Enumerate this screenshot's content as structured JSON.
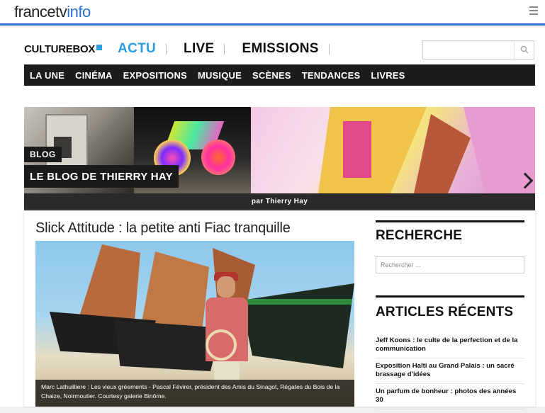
{
  "header": {
    "logo_part1": "francetv",
    "logo_part2": "info"
  },
  "brand": {
    "culturebox": "CULTUREBOX",
    "nav": [
      "ACTU",
      "LIVE",
      "EMISSIONS"
    ]
  },
  "menu": [
    "LA UNE",
    "CINÉMA",
    "EXPOSITIONS",
    "MUSIQUE",
    "SCÈNES",
    "TENDANCES",
    "LIVRES"
  ],
  "banner": {
    "tag": "BLOG",
    "title": "LE BLOG DE THIERRY HAY",
    "byline": "par Thierry Hay"
  },
  "article": {
    "title": "Slick Attitude : la petite anti Fiac tranquille",
    "caption": "Marc Lathuilliere : Les vieux gréements - Pascal Févirer, président des Amis du Sinagot, Régates du Bois de la Chaize, Noirmoutier. Courtesy galerie Binôme."
  },
  "sidebar": {
    "search_heading": "RECHERCHE",
    "search_placeholder": "Rechercher ...",
    "recent_heading": "ARTICLES RÉCENTS",
    "recent": [
      "Jeff Koons : le culte de la perfection et de la communication",
      "Exposition Haïti au Grand Palais : un sacré brassage d'idées",
      "Un parfum de bonheur : photos des années 30"
    ]
  },
  "colors": {
    "accent": "#2b9fe0",
    "brand_blue": "#2b6fd1",
    "menu_bg": "#1c1c1c"
  }
}
